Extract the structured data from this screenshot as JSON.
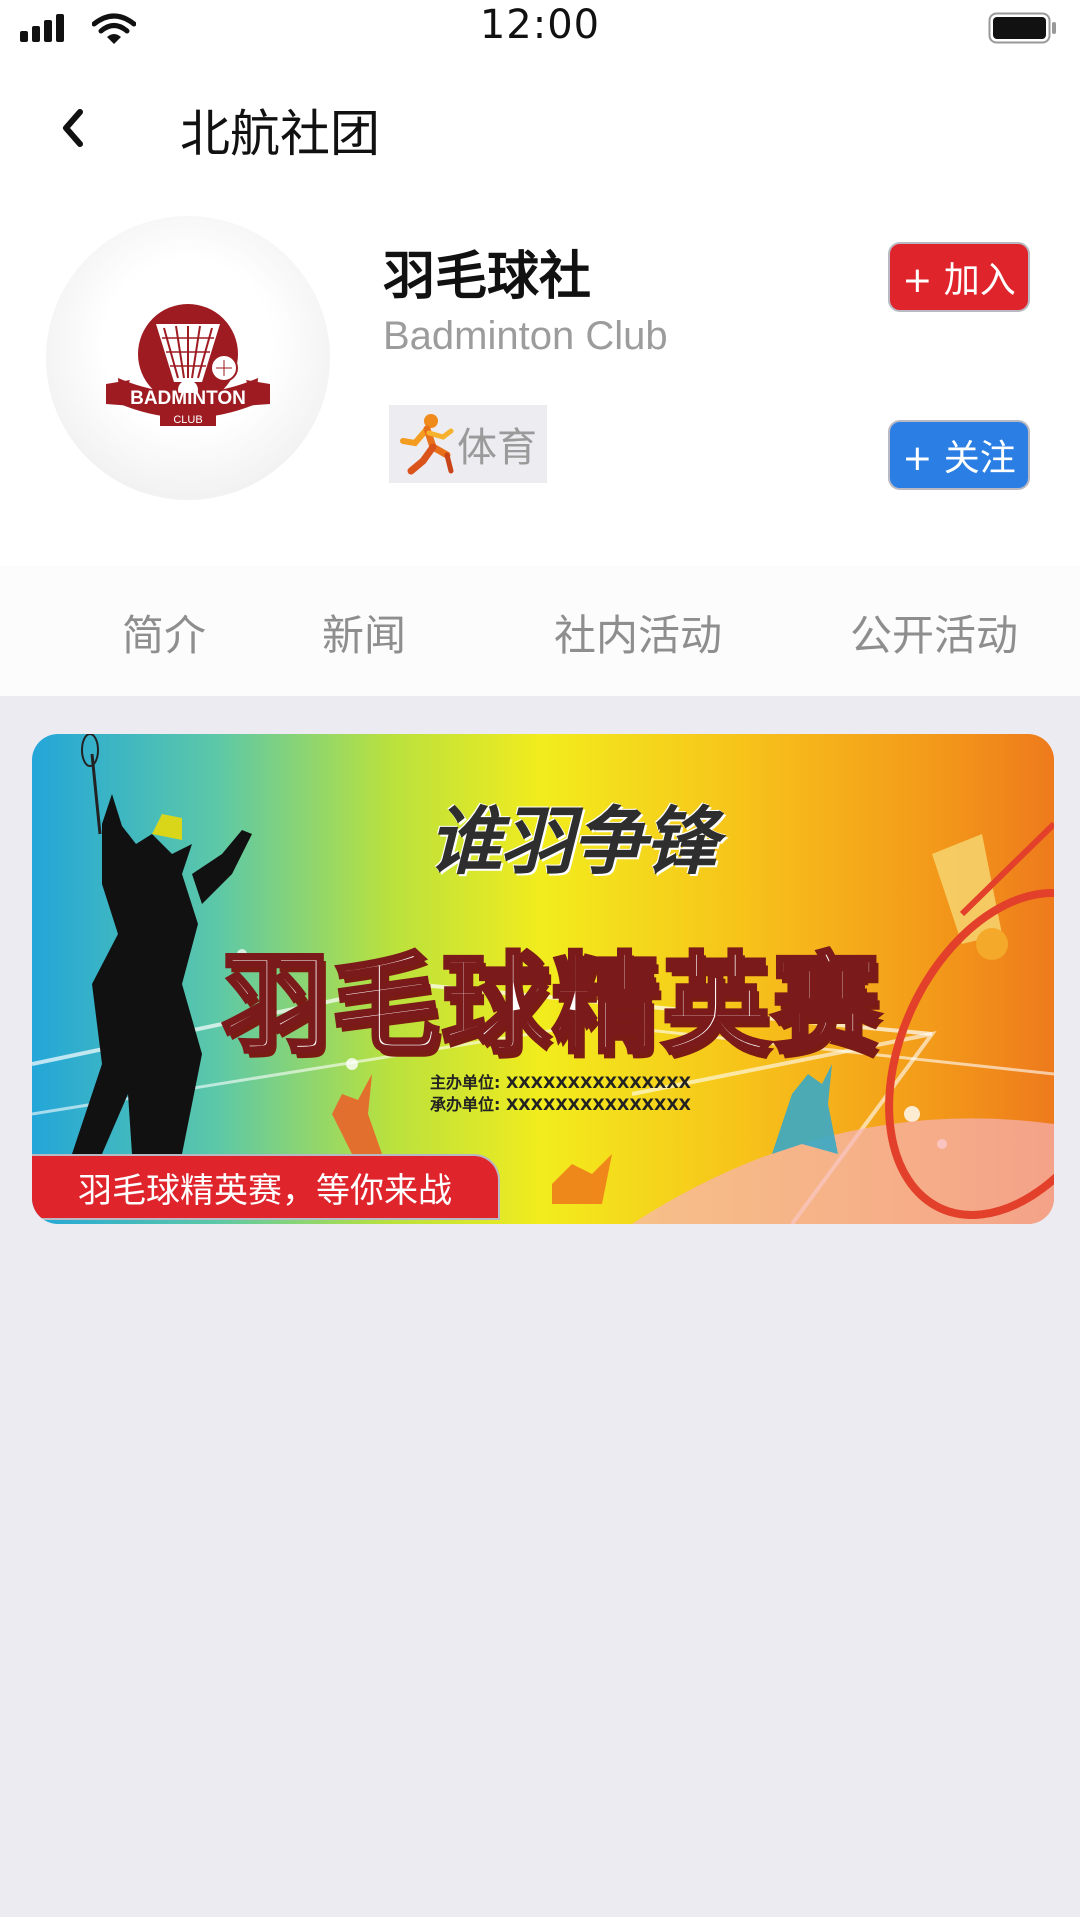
{
  "status_bar": {
    "time": "12:00"
  },
  "header": {
    "title": "北航社团",
    "back_icon": "chevron-left-icon"
  },
  "club": {
    "name": "羽毛球社",
    "name_en": "Badminton Club",
    "logo": {
      "text_main": "BADMINTON",
      "text_sub": "CLUB"
    },
    "category": {
      "icon": "runner-icon",
      "label": "体育"
    },
    "join_label": "+ 加入",
    "follow_label": "+ 关注"
  },
  "tabs": [
    {
      "label": "简介"
    },
    {
      "label": "新闻"
    },
    {
      "label": "社内活动"
    },
    {
      "label": "公开活动"
    }
  ],
  "banner": {
    "slogan": "谁羽争锋",
    "title": "羽毛球精英赛",
    "host_lines": "主办单位: XXXXXXXXXXXXXXX\n承办单位: XXXXXXXXXXXXXXX",
    "caption": "羽毛球精英赛，等你来战"
  },
  "colors": {
    "join_button": "#e0242c",
    "follow_button": "#2b7fe4",
    "page_background": "#ecebf2"
  }
}
